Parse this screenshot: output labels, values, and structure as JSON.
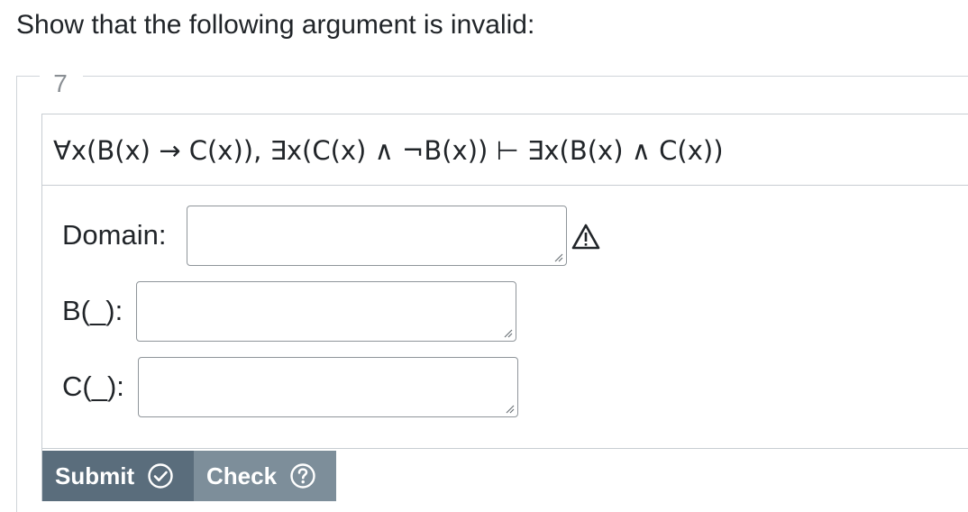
{
  "prompt": "Show that the following argument is invalid:",
  "question_number": "7",
  "argument": "∀x(B(x) → C(x)), ∃x(C(x) ∧ ¬B(x)) ⊢ ∃x(B(x) ∧ C(x))",
  "fields": {
    "domain": {
      "label": "Domain:",
      "value": ""
    },
    "b": {
      "label": "B(_):",
      "value": ""
    },
    "c": {
      "label": "C(_):",
      "value": ""
    }
  },
  "buttons": {
    "submit_label": "Submit",
    "check_label": "Check"
  },
  "icons": {
    "warning": "warning-triangle-icon",
    "submit": "check-circle-icon",
    "check": "question-circle-icon"
  },
  "colors": {
    "submit_bg": "#5a6d7c",
    "check_bg": "#7d8e9a",
    "text": "#212529",
    "border": "#c8cdd2"
  }
}
